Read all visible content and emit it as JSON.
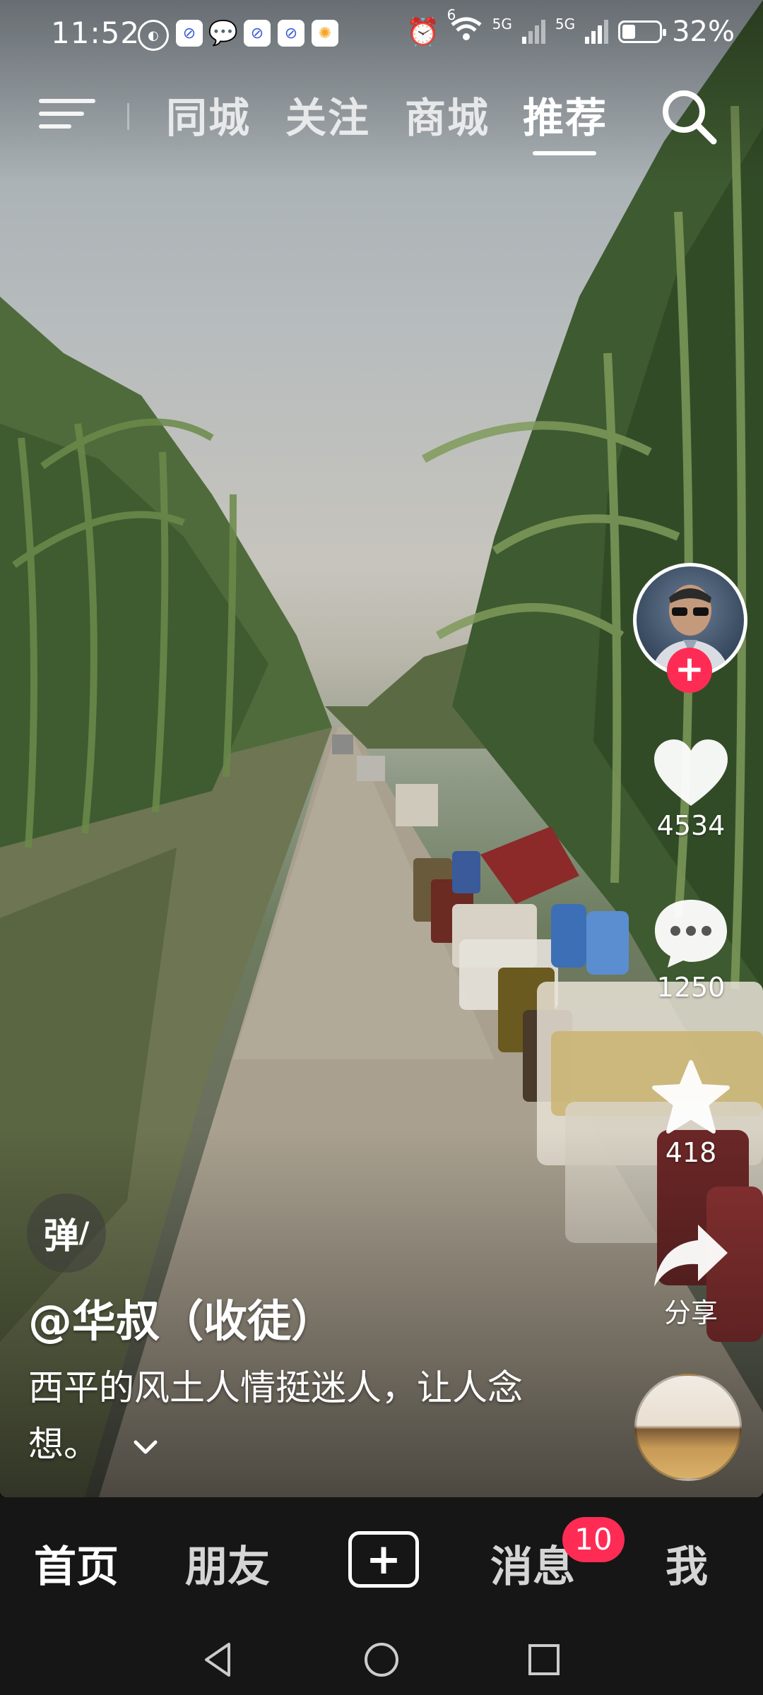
{
  "status_bar": {
    "time": "11:52",
    "signal_1": "5G",
    "signal_2": "5G",
    "wifi_superscript": "6",
    "battery": "32%"
  },
  "top_nav": {
    "tabs": [
      "同城",
      "关注",
      "商城",
      "推荐"
    ],
    "active_tab": "推荐"
  },
  "video": {
    "author": "@华叔（收徒）",
    "description": "西平的风土人情挺迷人，让人念想。",
    "danmu_label": "弹"
  },
  "actions": {
    "likes": "4534",
    "comments": "1250",
    "favorites": "418",
    "share_label": "分享"
  },
  "bottom_nav": {
    "home": "首页",
    "friends": "朋友",
    "create": "+",
    "messages": "消息",
    "messages_badge": "10",
    "me": "我"
  },
  "colors": {
    "accent": "#fe2c55",
    "nav_bg": "#161616"
  }
}
